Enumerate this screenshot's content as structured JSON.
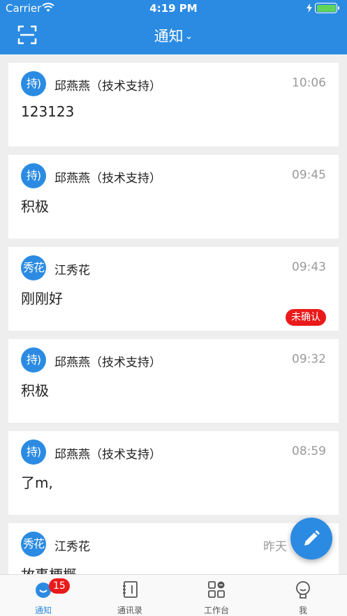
{
  "status_bar": {
    "carrier": "Carrier",
    "time": "4:19 PM"
  },
  "nav": {
    "title": "通知"
  },
  "messages": [
    {
      "avatar": "持)",
      "sender": "邱燕燕（技术支持）",
      "time": "10:06",
      "content": "123123"
    },
    {
      "avatar": "持)",
      "sender": "邱燕燕（技术支持）",
      "time": "09:45",
      "content": "积极"
    },
    {
      "avatar": "秀花",
      "sender": "江秀花",
      "time": "09:43",
      "content": "刚刚好",
      "badge": "未确认"
    },
    {
      "avatar": "持)",
      "sender": "邱燕燕（技术支持）",
      "time": "09:32",
      "content": "积极"
    },
    {
      "avatar": "持)",
      "sender": "邱燕燕（技术支持）",
      "time": "08:59",
      "content": "了m,"
    },
    {
      "avatar": "秀花",
      "sender": "江秀花",
      "time": "昨天",
      "content": "故事梗概"
    }
  ],
  "tabbar": {
    "tabs": [
      {
        "label": "通知",
        "badge": "15",
        "icon": "bell-icon"
      },
      {
        "label": "通讯录",
        "icon": "contacts-icon"
      },
      {
        "label": "工作台",
        "icon": "workbench-icon"
      },
      {
        "label": "我",
        "icon": "profile-icon"
      }
    ]
  },
  "colors": {
    "primary": "#2b8be2",
    "alert": "#ea1a1a"
  }
}
